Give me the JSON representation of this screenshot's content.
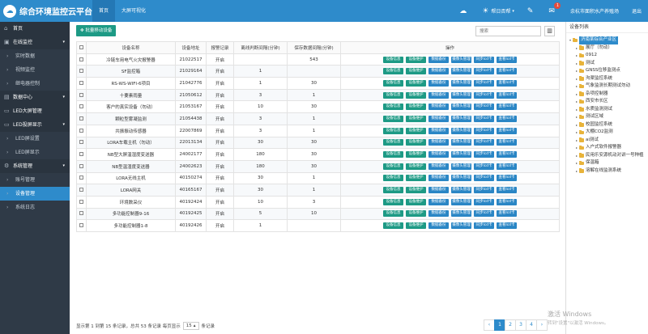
{
  "app": {
    "logo_glyph": "☁",
    "title": "综合环境监控云平台"
  },
  "top_nav": [
    {
      "label": "首页"
    },
    {
      "label": "大屏可视化"
    }
  ],
  "top_right": {
    "weather_label": "帮日否帮",
    "notification_count": "1",
    "org_label": "余杭市面积水产养殖场",
    "logout_label": "退出"
  },
  "sidebar": {
    "items": [
      {
        "label": "首页",
        "icon": "home-icon",
        "glyph": "⌂",
        "type": "group"
      },
      {
        "label": "在线监控",
        "icon": "monitor-icon",
        "glyph": "▣",
        "type": "group",
        "caret": "▾"
      },
      {
        "label": "实时数据",
        "icon": "chevron-right-icon",
        "glyph": "›",
        "type": "sub"
      },
      {
        "label": "视频监控",
        "icon": "chevron-right-icon",
        "glyph": "›",
        "type": "sub"
      },
      {
        "label": "继电器控制",
        "icon": "chevron-right-icon",
        "glyph": "›",
        "type": "sub"
      },
      {
        "label": "数据中心",
        "icon": "database-icon",
        "glyph": "▤",
        "type": "group",
        "caret": "▾"
      },
      {
        "label": "LED大屏管理",
        "icon": "screen-icon",
        "glyph": "▭",
        "type": "group"
      },
      {
        "label": "LED投屏显示",
        "icon": "display-icon",
        "glyph": "▭",
        "type": "group",
        "caret": "▾"
      },
      {
        "label": "LED屏设置",
        "icon": "chevron-right-icon",
        "glyph": "›",
        "type": "sub"
      },
      {
        "label": "LED屏显示",
        "icon": "chevron-right-icon",
        "glyph": "›",
        "type": "sub"
      },
      {
        "label": "系统管理",
        "icon": "gear-icon",
        "glyph": "⚙",
        "type": "group",
        "caret": "▾"
      },
      {
        "label": "账号管理",
        "icon": "chevron-right-icon",
        "glyph": "›",
        "type": "sub"
      },
      {
        "label": "设备管理",
        "icon": "chevron-right-icon",
        "glyph": "›",
        "type": "sub",
        "active": true
      },
      {
        "label": "系统日志",
        "icon": "chevron-right-icon",
        "glyph": "›",
        "type": "sub"
      }
    ]
  },
  "toolbar": {
    "batch_label": "批量移动设备",
    "search_placeholder": "搜索",
    "columns_glyph": "▥"
  },
  "table": {
    "headers": [
      "设备名称",
      "设备地址",
      "报警记录",
      "离线判断间隔(分钟)",
      "保存数据间隔(分钟)",
      "操作"
    ],
    "op_labels": [
      "设备信息",
      "设备维护",
      "数据备份",
      "摄像头管理",
      "同步lcd卡",
      "查看lcd卡"
    ],
    "rows": [
      [
        "冷链车用电气火灾报警器",
        "21022517",
        "开启",
        "",
        "543"
      ],
      [
        "SF监控箱",
        "21029164",
        "开启",
        "1",
        ""
      ],
      [
        "RS-WS-WIFI-6项目",
        "21042776",
        "开启",
        "1",
        "30"
      ],
      [
        "十要素雨量",
        "21050612",
        "开启",
        "3",
        "1"
      ],
      [
        "客户的真实设备（勿动）",
        "21053167",
        "开启",
        "10",
        "30"
      ],
      [
        "颗粒型雾凝监测",
        "21054438",
        "开启",
        "3",
        "1"
      ],
      [
        "共振振动传感器",
        "22007869",
        "开启",
        "3",
        "1"
      ],
      [
        "LORA车载主机（勿动）",
        "22013134",
        "开启",
        "30",
        "30"
      ],
      [
        "NB型大屏温湿度变送器",
        "24002177",
        "开启",
        "180",
        "30"
      ],
      [
        "NB型温湿度变送器",
        "24002623",
        "开启",
        "180",
        "30"
      ],
      [
        "LORA无线主机",
        "40150274",
        "开启",
        "30",
        "1"
      ],
      [
        "LORA网关",
        "40165167",
        "开启",
        "30",
        "1"
      ],
      [
        "环境数采仪",
        "40192424",
        "开启",
        "10",
        "3"
      ],
      [
        "多功能控制器9-16",
        "40192425",
        "开启",
        "5",
        "10"
      ],
      [
        "多功能控制器1-8",
        "40192426",
        "开启",
        "1",
        ""
      ]
    ]
  },
  "pagination": {
    "info_prefix": "显示第 1 到第 15 条记录，总共 53 条记录  每页显示",
    "page_size": "15",
    "page_size_caret": "▴",
    "info_suffix": "条记录",
    "pages": [
      "‹",
      "1",
      "2",
      "3",
      "4",
      "›"
    ],
    "active_page": "1"
  },
  "device_tree": {
    "title": "设备列表",
    "root": "济南某综合产业区",
    "nodes": [
      "展厅（勿动）",
      "0912",
      "测试",
      "GNSS位移监测点",
      "沟渠监控系统",
      "气象监测长期测试勿动",
      "杂项控制器",
      "西安市长区",
      "水质监测测试",
      "测试区域",
      "校园监控系统",
      "大棚CO2监测",
      "ai测试",
      "入户式软件报警器",
      "民用乐安源机动对讲一号种植",
      "保温箱",
      "溶解在线监测系统"
    ]
  },
  "watermark": {
    "line1": "激活 Windows",
    "line2": "转到\"设置\"以激活 Windows。"
  }
}
